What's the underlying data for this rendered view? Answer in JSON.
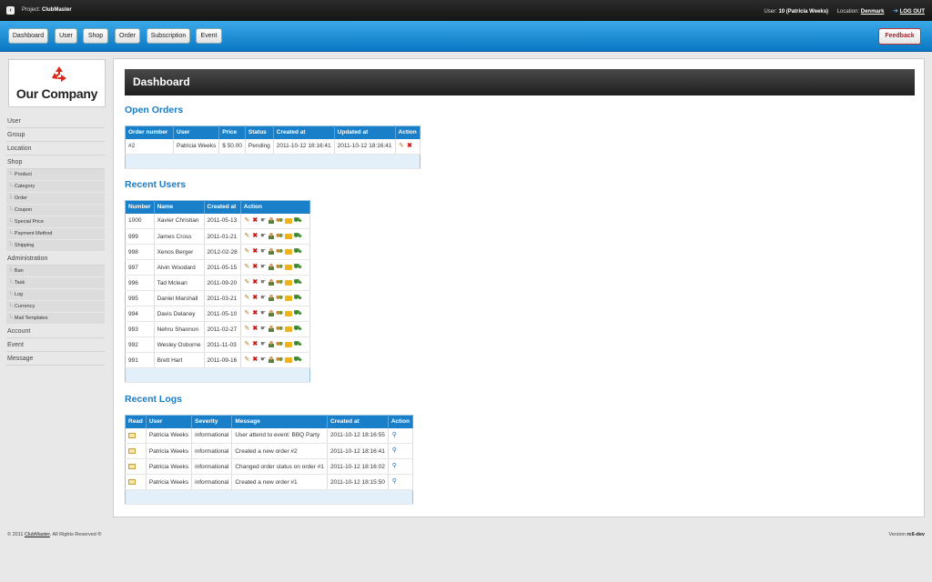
{
  "topbar": {
    "back_glyph": "‹",
    "project_label": "Project:",
    "project_name": "ClubMaster",
    "user_label": "User:",
    "user_value": "10 (Patricia Weeks)",
    "location_label": "Location:",
    "location_value": "Denmark",
    "logout": "LOG OUT"
  },
  "nav": {
    "items": [
      "Dashboard",
      "User",
      "Shop",
      "Order",
      "Subscription",
      "Event"
    ],
    "feedback": "Feedback"
  },
  "logo": {
    "name": "Our Company"
  },
  "sidebar": {
    "user": "User",
    "group": "Group",
    "location": "Location",
    "shop": "Shop",
    "shop_items": [
      "Product",
      "Category",
      "Order",
      "Coupon",
      "Special Price",
      "Payment Method",
      "Shipping"
    ],
    "administration": "Administration",
    "admin_items": [
      "Ban",
      "Task",
      "Log",
      "Currency",
      "Mail Templates"
    ],
    "account": "Account",
    "event": "Event",
    "message": "Message"
  },
  "dashboard": {
    "title": "Dashboard"
  },
  "open_orders": {
    "title": "Open Orders",
    "headers": [
      "Order number",
      "User",
      "Price",
      "Status",
      "Created at",
      "Updated at",
      "Action"
    ],
    "rows": [
      [
        "#2",
        "Patricia Weeks",
        "$ 50.00",
        "Pending",
        "2011-10-12 18:16:41",
        "2011-10-12 18:16:41"
      ]
    ]
  },
  "recent_users": {
    "title": "Recent Users",
    "headers": [
      "Number",
      "Name",
      "Created at",
      "Action"
    ],
    "rows": [
      [
        "1000",
        "Xavier Christian",
        "2011-05-13"
      ],
      [
        "999",
        "James Cross",
        "2011-01-21"
      ],
      [
        "998",
        "Xenos Berger",
        "2012-02-28"
      ],
      [
        "997",
        "Alvin Woodard",
        "2011-05-15"
      ],
      [
        "996",
        "Tad Mclean",
        "2011-09-20"
      ],
      [
        "995",
        "Daniel Marshall",
        "2011-03-21"
      ],
      [
        "994",
        "Davis Delaney",
        "2011-05-10"
      ],
      [
        "993",
        "Nehru Shannon",
        "2011-02-27"
      ],
      [
        "992",
        "Wesley Osborne",
        "2011-11-03"
      ],
      [
        "991",
        "Brett Hart",
        "2011-09-16"
      ]
    ]
  },
  "recent_logs": {
    "title": "Recent Logs",
    "headers": [
      "Read",
      "User",
      "Severity",
      "Message",
      "Created at",
      "Action"
    ],
    "rows": [
      [
        "Patricia Weeks",
        "informational",
        "User attend to event: BBQ Party",
        "2011-10-12 18:16:55"
      ],
      [
        "Patricia Weeks",
        "informational",
        "Created a new order #2",
        "2011-10-12 18:16:41"
      ],
      [
        "Patricia Weeks",
        "informational",
        "Changed order status on order #1",
        "2011-10-12 18:16:02"
      ],
      [
        "Patricia Weeks",
        "informational",
        "Created a new order #1",
        "2011-10-12 18:15:50"
      ]
    ]
  },
  "footer": {
    "copyright_prefix": "© 2011",
    "copyright_link": "ClubMaster",
    "copyright_suffix": ". All Rights Reserved ®",
    "version_label": "Version",
    "version_value": "rc6-dev"
  },
  "colors": {
    "accent": "#1a7fc9",
    "nav_blue": "#1e90d8",
    "feedback_red": "#c0151b",
    "logo_red": "#d9281c"
  },
  "icons": [
    "back-icon",
    "logout-arrow-icon",
    "recycle-logo-icon",
    "edit-icon",
    "delete-icon",
    "ban-icon",
    "user-icon",
    "group-icon",
    "card-icon",
    "cart-icon",
    "read-mail-icon",
    "view-icon"
  ]
}
